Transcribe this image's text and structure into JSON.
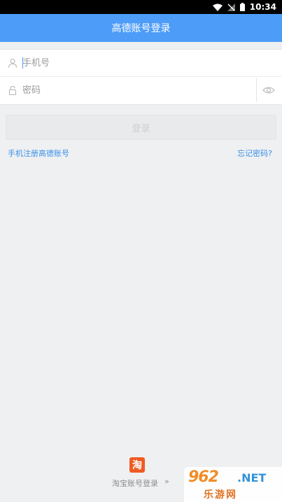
{
  "status_bar": {
    "time": "10:34"
  },
  "app_bar": {
    "title": "高德账号登录"
  },
  "form": {
    "phone_placeholder": "手机号",
    "password_placeholder": "密码"
  },
  "login_button": {
    "label": "登录"
  },
  "links": {
    "register": "手机注册高德账号",
    "forgot": "忘记密码?"
  },
  "taobao": {
    "logo_char": "淘",
    "label": "淘宝账号登录",
    "arrow": "»"
  },
  "watermark": {
    "top": "962",
    "net": ".NET",
    "bottom": "乐游网"
  },
  "colors": {
    "accent": "#4d9df8",
    "link": "#3a8fe8",
    "background": "#eff0f2",
    "taobao": "#ef5b23"
  }
}
